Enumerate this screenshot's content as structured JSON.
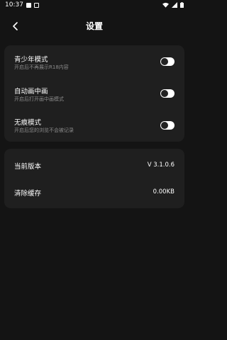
{
  "status_bar": {
    "time": "10:37",
    "left_icons": [
      "app-notification-icon",
      "app-notification-icon"
    ],
    "right_icons": [
      "wifi-icon",
      "signal-icon",
      "battery-icon"
    ]
  },
  "header": {
    "title": "设置",
    "back_icon": "chevron-left-icon"
  },
  "settings_toggles": [
    {
      "title": "青少年模式",
      "subtitle": "开启后不再展示R18内容",
      "enabled": false
    },
    {
      "title": "自动画中画",
      "subtitle": "开启后打开画中画模式",
      "enabled": false
    },
    {
      "title": "无痕模式",
      "subtitle": "开启后您的浏览不会被记录",
      "enabled": false
    }
  ],
  "info_rows": [
    {
      "label": "当前版本",
      "value": "V 3.1.0.6"
    },
    {
      "label": "清除缓存",
      "value": "0.00KB"
    }
  ],
  "colors": {
    "background": "#141414",
    "card": "#1f1f1f",
    "subtitle": "#8a8a8a",
    "toggle_track": "#ffffff",
    "toggle_knob": "#222222"
  }
}
